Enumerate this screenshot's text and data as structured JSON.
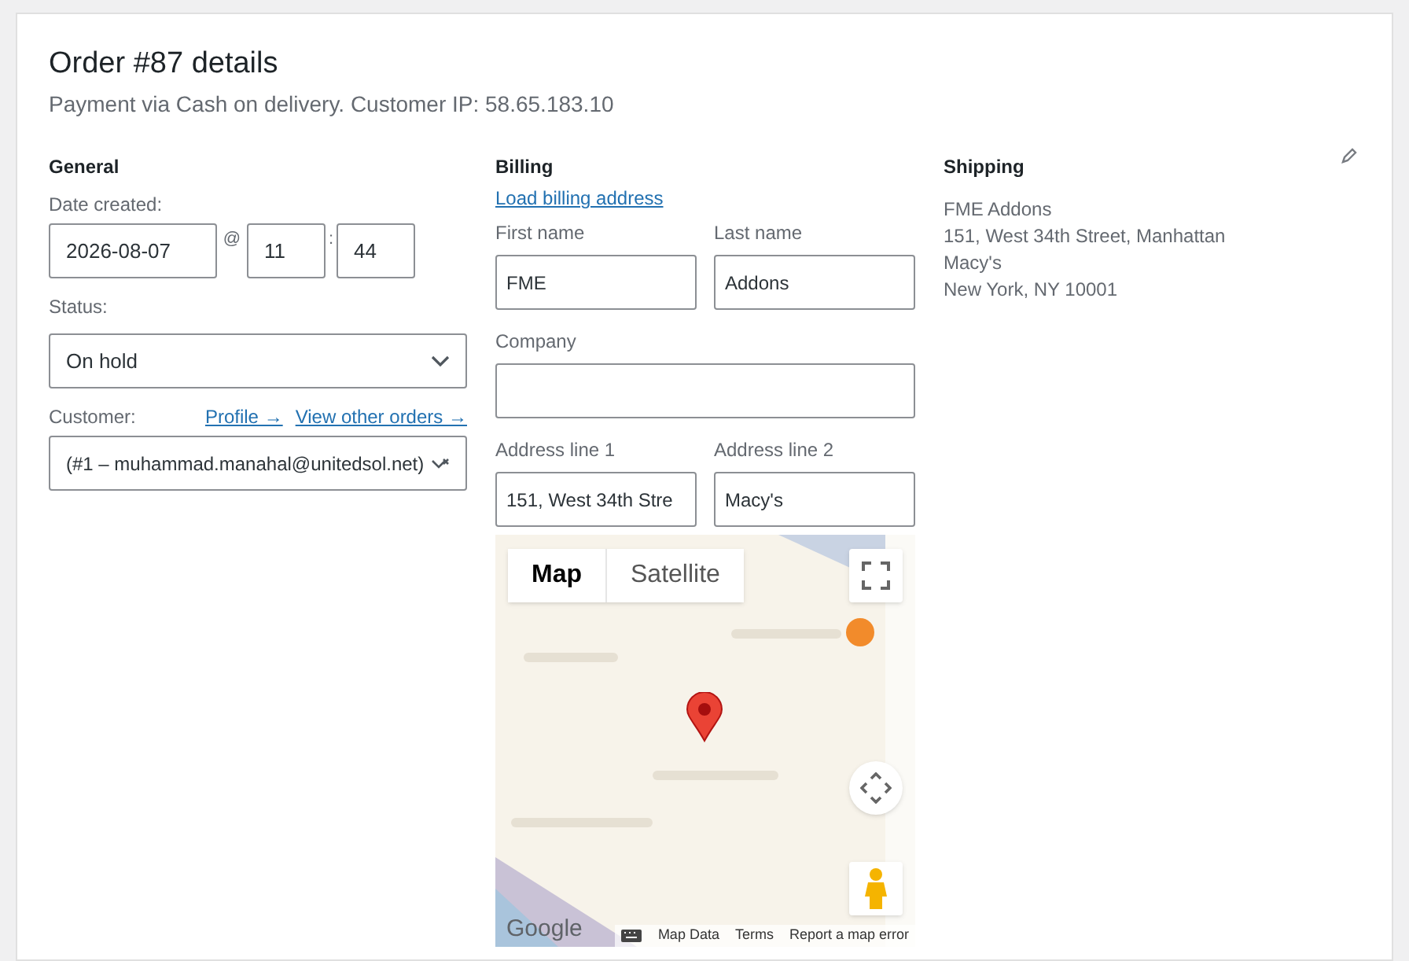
{
  "order": {
    "title": "Order #87 details",
    "subtitle": "Payment via Cash on delivery. Customer IP: 58.65.183.10"
  },
  "general": {
    "heading": "General",
    "date_label": "Date created:",
    "date": "2026-08-07",
    "at": "@",
    "hour": "11",
    "colon": ":",
    "minute": "44",
    "status_label": "Status:",
    "status": "On hold",
    "customer_label": "Customer:",
    "links": [
      "Profile →",
      "View other orders →"
    ],
    "customer": "(#1 – muhammad.manahal@unitedsol.net)"
  },
  "billing": {
    "heading": "Billing",
    "load_link": "Load billing address",
    "fields": [
      {
        "label": "First name",
        "value": "FME"
      },
      {
        "label": "Last name",
        "value": "Addons"
      },
      {
        "label": "Company"
      },
      {
        "label": "Address line 1",
        "value": "151, West 34th Stre"
      },
      {
        "label": "Address line 2",
        "value": "Macy's"
      }
    ],
    "map": {
      "map_types": [
        {
          "label": "Map",
          "selected": true
        },
        {
          "label": "Satellite",
          "selected": false
        }
      ],
      "logo": "Google",
      "footer_links": [
        "Map Data",
        "Terms",
        "Report a map error"
      ]
    }
  },
  "shipping": {
    "heading": "Shipping",
    "lines": [
      "FME Addons",
      "151, West 34th Street, Manhattan",
      "Macy's",
      "New York, NY 10001"
    ]
  }
}
